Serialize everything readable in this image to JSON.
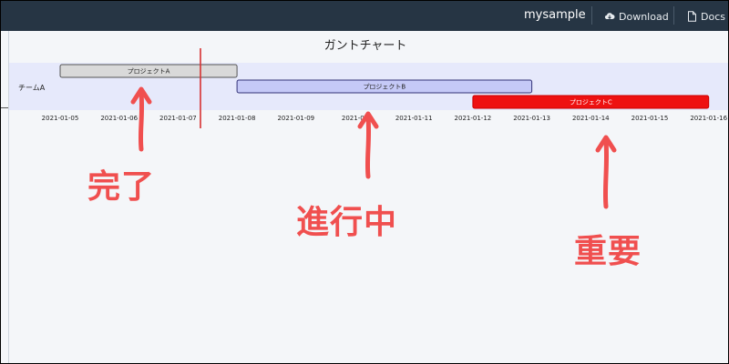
{
  "header": {
    "app_name": "mysample",
    "download_label": "Download",
    "docs_label": "Docs"
  },
  "chart_data": {
    "type": "gantt",
    "title": "ガントチャート",
    "row_label": "チームA",
    "x_ticks": [
      "2021-01-05",
      "2021-01-06",
      "2021-01-07",
      "2021-01-08",
      "2021-01-09",
      "2021-01-10",
      "2021-01-11",
      "2021-01-12",
      "2021-01-13",
      "2021-01-14",
      "2021-01-15",
      "2021-01-16"
    ],
    "x_tick_visible": [
      "2021-01-05",
      "2021-01-06",
      "2021-01-07",
      "2021-01-08",
      "2021-01-09",
      "2021-01",
      "2021-01-11",
      "2021-01-12",
      "2021-01-13",
      "2021-01-14",
      "2021-01-15",
      "2021-01-16"
    ],
    "today": "2021-01-07.5",
    "tasks": [
      {
        "name": "プロジェクトA",
        "start": 0,
        "end": 3,
        "lane": 0,
        "status": "done",
        "fill": "#d9d9d9",
        "stroke": "#555555",
        "text": "#222222"
      },
      {
        "name": "プロジェクトB",
        "start": 3,
        "end": 8,
        "lane": 1,
        "status": "active",
        "fill": "#c5c9f7",
        "stroke": "#333377",
        "text": "#222222"
      },
      {
        "name": "プロジェクトC",
        "start": 7,
        "end": 11,
        "lane": 2,
        "status": "crit",
        "fill": "#ee1111",
        "stroke": "#cc0000",
        "text": "#ffffff"
      }
    ]
  },
  "annotations": [
    {
      "label": "完了",
      "color": "#f04f4f"
    },
    {
      "label": "進行中",
      "color": "#f04f4f"
    },
    {
      "label": "重要",
      "color": "#f04f4f"
    }
  ]
}
